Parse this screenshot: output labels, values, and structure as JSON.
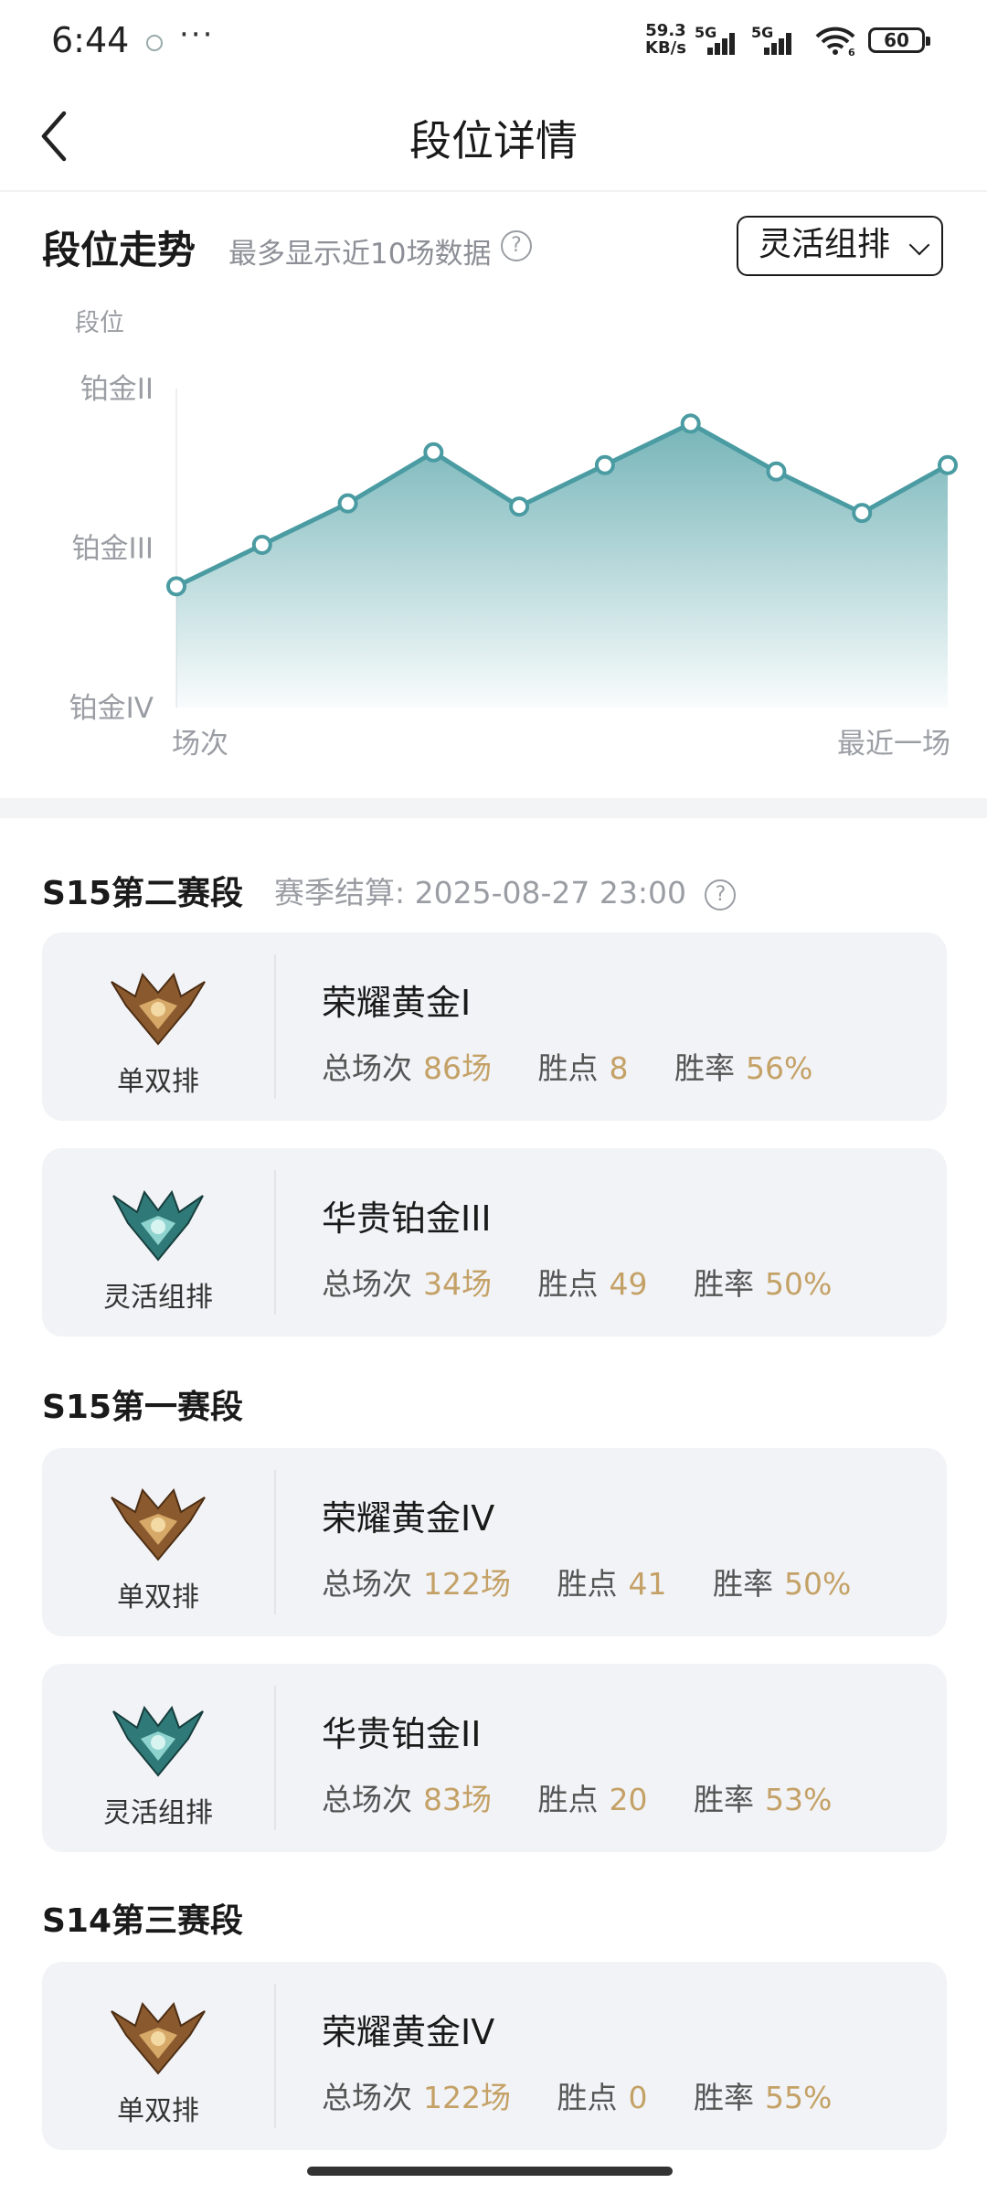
{
  "status_bar": {
    "time": "6:44",
    "more": "···",
    "net_speed_value": "59.3",
    "net_speed_unit": "KB/s",
    "signal_1": "5G",
    "signal_2": "5G",
    "wifi_badge": "6",
    "battery": "60"
  },
  "header": {
    "title": "段位详情"
  },
  "trend": {
    "title": "段位走势",
    "hint": "最多显示近10场数据",
    "dropdown_value": "灵活组排",
    "accent_color": "#4a9ba2"
  },
  "chart_data": {
    "type": "area",
    "ylabel": "段位",
    "yticks": [
      "铂金IV",
      "铂金III",
      "铂金II"
    ],
    "xlabel_start": "场次",
    "xlabel_end": "最近一场",
    "x": [
      1,
      2,
      3,
      4,
      5,
      6,
      7,
      8,
      9,
      10
    ],
    "values": [
      0.38,
      0.51,
      0.64,
      0.8,
      0.63,
      0.76,
      0.89,
      0.74,
      0.61,
      0.76
    ],
    "ylim": [
      0,
      1
    ]
  },
  "seasons": [
    {
      "name": "S15第二赛段",
      "settle": "赛季结算: 2025-08-27 23:00",
      "cards": [
        {
          "queue": "单双排",
          "rank": "荣耀黄金I",
          "total_label": "总场次",
          "total": "86场",
          "lp_label": "胜点",
          "lp": "8",
          "wr_label": "胜率",
          "wr": "56%",
          "emblem": "gold-emblem-icon"
        },
        {
          "queue": "灵活组排",
          "rank": "华贵铂金III",
          "total_label": "总场次",
          "total": "34场",
          "lp_label": "胜点",
          "lp": "49",
          "wr_label": "胜率",
          "wr": "50%",
          "emblem": "platinum-emblem-icon"
        }
      ]
    },
    {
      "name": "S15第一赛段",
      "cards": [
        {
          "queue": "单双排",
          "rank": "荣耀黄金IV",
          "total_label": "总场次",
          "total": "122场",
          "lp_label": "胜点",
          "lp": "41",
          "wr_label": "胜率",
          "wr": "50%",
          "emblem": "gold-emblem-icon"
        },
        {
          "queue": "灵活组排",
          "rank": "华贵铂金II",
          "total_label": "总场次",
          "total": "83场",
          "lp_label": "胜点",
          "lp": "20",
          "wr_label": "胜率",
          "wr": "53%",
          "emblem": "platinum-emblem-icon"
        }
      ]
    },
    {
      "name": "S14第三赛段",
      "cards": [
        {
          "queue": "单双排",
          "rank": "荣耀黄金IV",
          "total_label": "总场次",
          "total": "122场",
          "lp_label": "胜点",
          "lp": "0",
          "wr_label": "胜率",
          "wr": "55%",
          "emblem": "gold-emblem-icon"
        }
      ]
    }
  ]
}
